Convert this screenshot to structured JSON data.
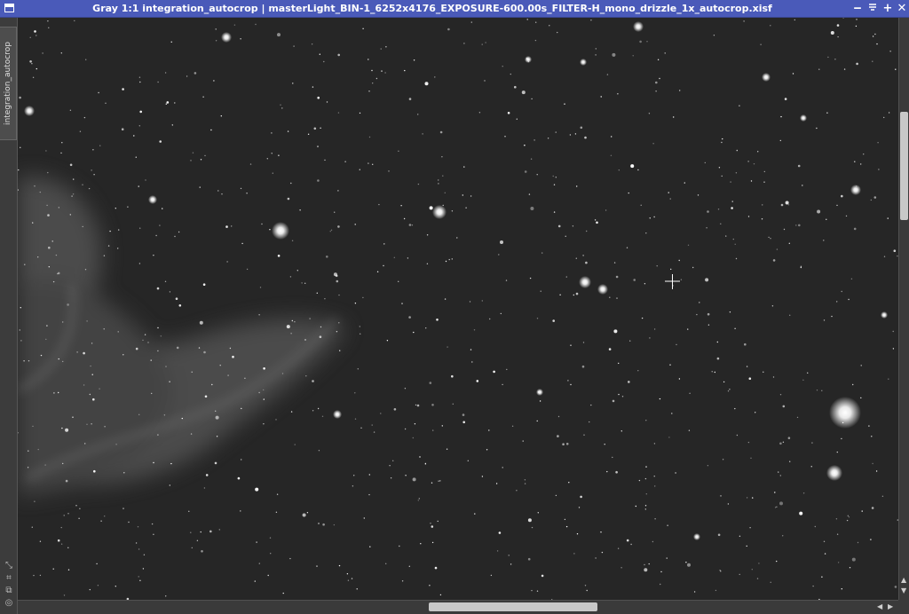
{
  "window": {
    "title": "Gray 1:1 integration_autocrop | masterLight_BIN-1_6252x4176_EXPOSURE-600.00s_FILTER-H_mono_drizzle_1x_autocrop.xisf",
    "controls": {
      "minimize": "‒",
      "shade": "⯐",
      "maximize": "+",
      "close": "✕"
    }
  },
  "sidebar": {
    "tab_label": "integration_autocrop",
    "icons": [
      "zoom-fit-icon",
      "fit-window-icon",
      "copy-icon",
      "lock-icon"
    ]
  },
  "viewport": {
    "background": "#262626",
    "cursor": "crosshair"
  },
  "scrollbars": {
    "horizontal_position": 0.6,
    "vertical_position": 0.21
  },
  "colors": {
    "titlebar": "#4a5ab9",
    "frame": "#3c3c3c",
    "scroll_thumb": "#c8c8c8"
  }
}
